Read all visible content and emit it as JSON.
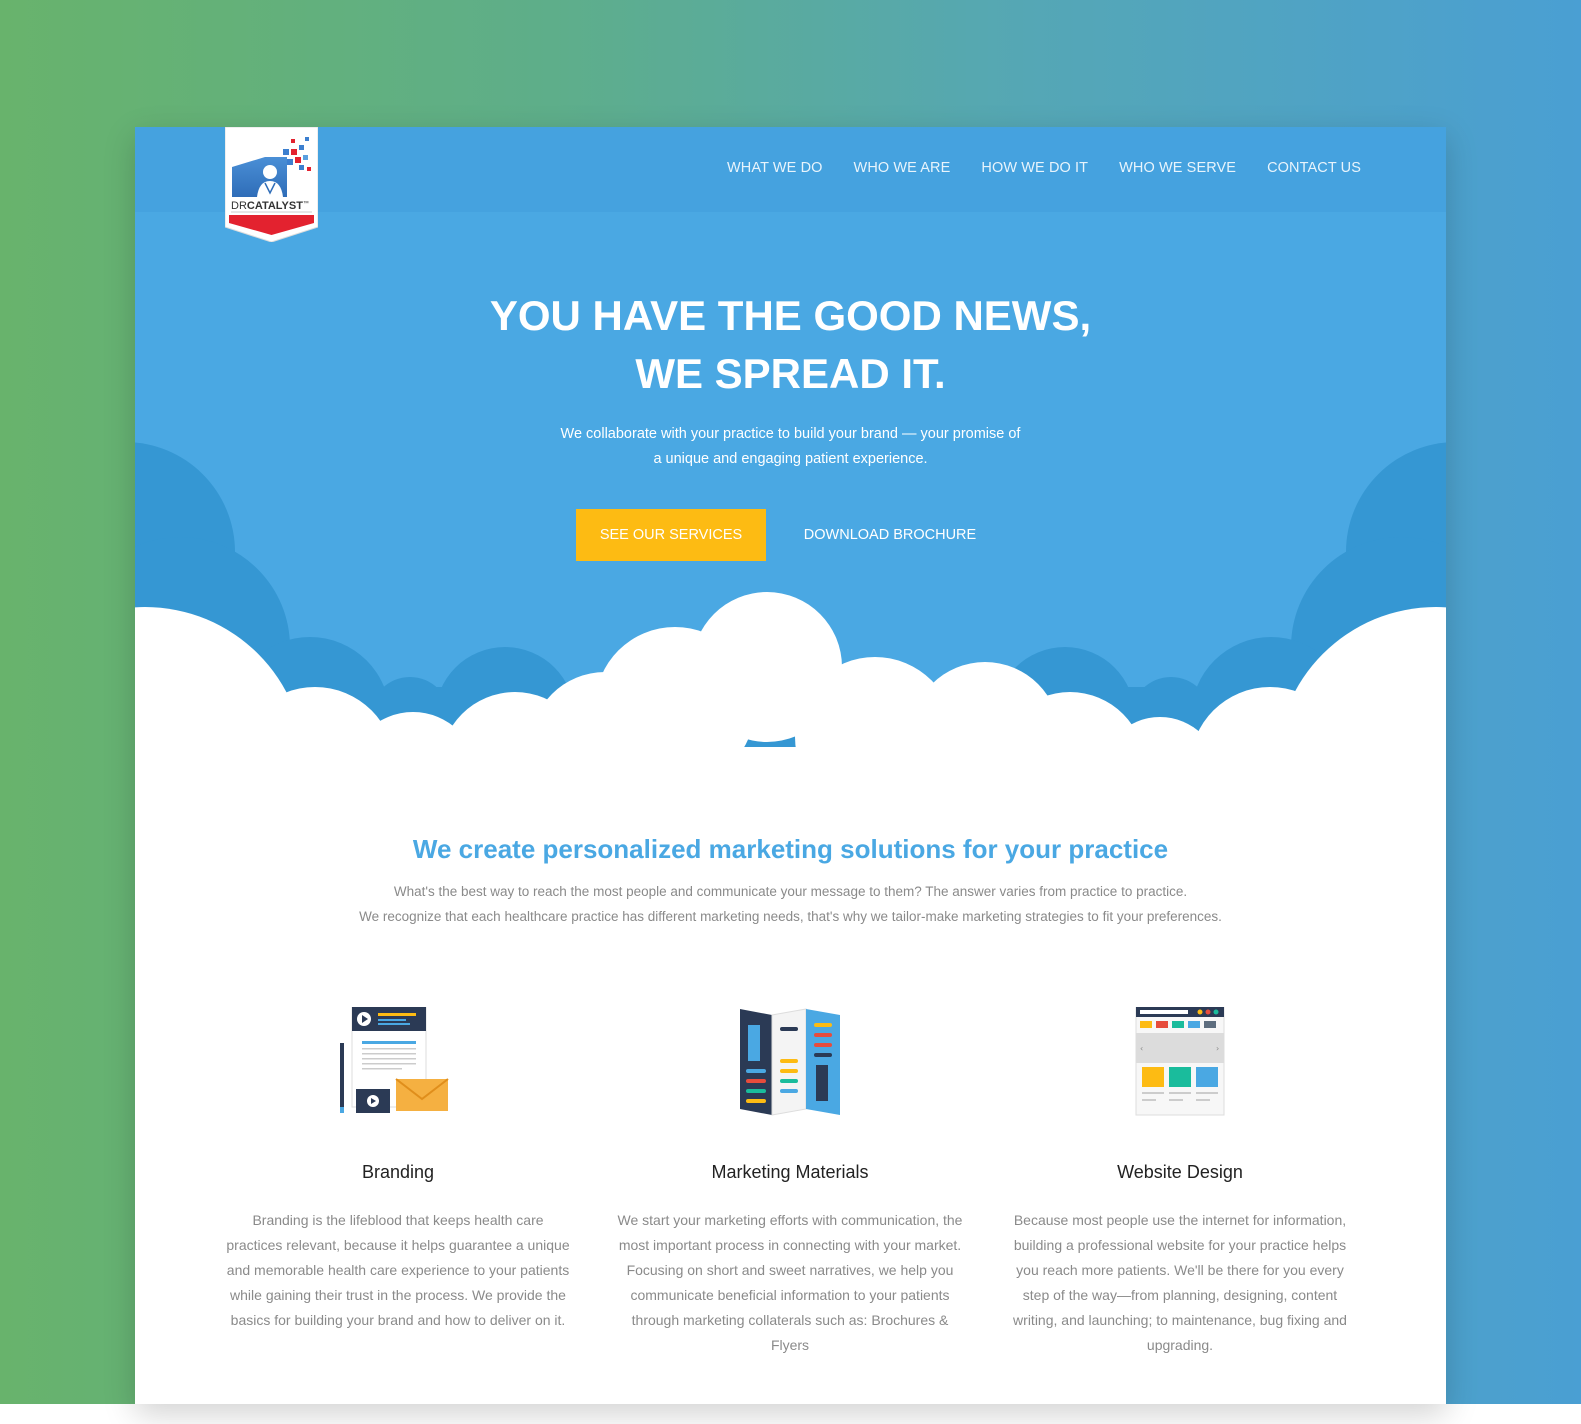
{
  "colors": {
    "primary_blue": "#4aa8e3",
    "accent_yellow": "#fdbb13",
    "logo_red": "#e3222f"
  },
  "logo": {
    "text_prefix": "DR",
    "text_main": "CATALYST",
    "trademark": "™"
  },
  "nav": {
    "items": [
      "WHAT WE DO",
      "WHO WE ARE",
      "HOW WE DO IT",
      "WHO WE SERVE",
      "CONTACT US"
    ]
  },
  "hero": {
    "headline_line1": "YOU HAVE THE GOOD NEWS,",
    "headline_line2": "WE SPREAD IT.",
    "subline_line1": "We collaborate with your practice to build your brand — your promise of",
    "subline_line2": "a unique and engaging patient experience.",
    "primary_cta": "SEE OUR SERVICES",
    "secondary_cta": "DOWNLOAD BROCHURE"
  },
  "intro": {
    "title": "We create personalized marketing solutions for your practice",
    "text_line1": "What's the best way to reach the most people and communicate your message to them? The answer varies from practice to practice.",
    "text_line2": "We recognize that each healthcare practice has different marketing needs, that's why we tailor-make marketing strategies to fit your preferences."
  },
  "services": [
    {
      "icon": "branding-icon",
      "title": "Branding",
      "text": "Branding is the lifeblood that keeps health care practices relevant, because it helps guarantee a unique and memorable health care experience to your patients while gaining their trust in the process. We provide the basics for building your brand and how to deliver on it."
    },
    {
      "icon": "brochure-icon",
      "title": "Marketing Materials",
      "text": "We start your marketing efforts with communication, the most important process in connecting with your market. Focusing on short and sweet narratives, we help you communicate beneficial information to your patients through marketing collaterals such as: Brochures & Flyers"
    },
    {
      "icon": "website-icon",
      "title": "Website Design",
      "text": "Because most people use the internet for information, building a professional website for your practice helps you reach more patients. We'll be there for you every step of the way—from planning, designing, content writing, and launching; to maintenance, bug fixing and upgrading."
    }
  ]
}
